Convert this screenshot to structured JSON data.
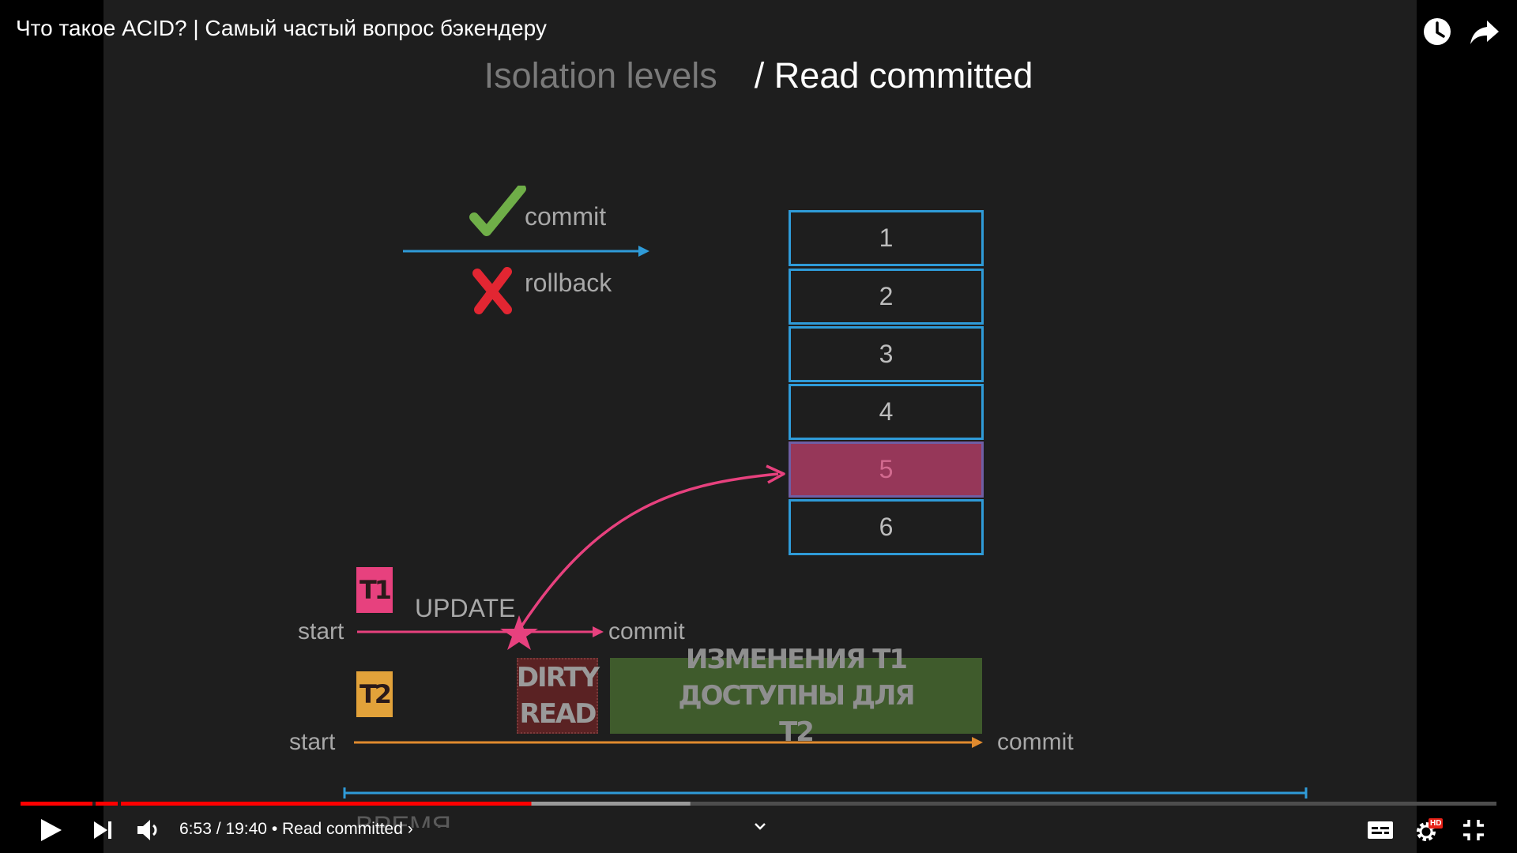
{
  "window": {
    "title": "Что такое ACID? | Самый частый вопрос бэкендеру"
  },
  "slide": {
    "heading_prev": "Isolation levels",
    "heading_sep": "/",
    "heading_current": "Read committed",
    "legend": {
      "commit": "commit",
      "rollback": "rollback"
    },
    "rows": [
      "1",
      "2",
      "3",
      "4",
      "5",
      "6"
    ],
    "highlighted_row": "5",
    "t1": {
      "tag": "T1",
      "action": "UPDATE",
      "start": "start",
      "end": "commit"
    },
    "t2": {
      "tag": "T2",
      "start": "start",
      "end": "commit"
    },
    "dirty_read": [
      "DIRTY",
      "READ"
    ],
    "note_line1": "ИЗМЕНЕНИЯ Т1 ДОСТУПНЫ ДЛЯ",
    "note_line2": "Т2",
    "time_axis_label": "ВРЕМЯ",
    "colors": {
      "blue": "#2f9bd8",
      "pink": "#e7417e",
      "orange": "#e08a2e",
      "green_check": "#6fae48",
      "red_x": "#e22632",
      "dirty_bg": "#5a2223",
      "note_bg": "#3f5b2c"
    }
  },
  "player": {
    "current_time": "6:53",
    "duration": "19:40",
    "separator": "/",
    "chapter": "Read committed",
    "progress_played": 0.3461,
    "progress_buffered": 0.4538,
    "accent": "#ff0000",
    "hd_badge": "HD",
    "icons": [
      "watch-later-icon",
      "share-icon",
      "play-icon",
      "next-icon",
      "volume-icon",
      "chevron-down-icon",
      "subtitles-icon",
      "settings-icon",
      "exit-fullscreen-icon"
    ]
  }
}
